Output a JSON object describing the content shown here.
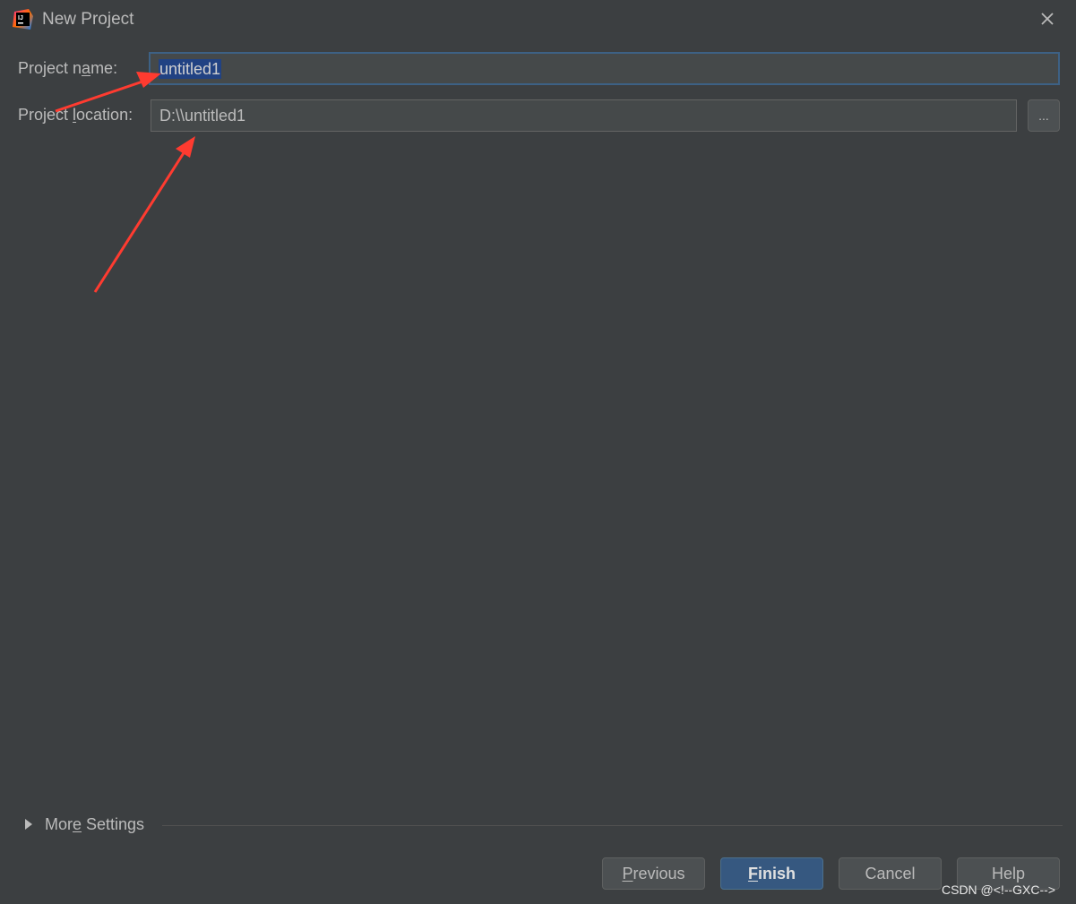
{
  "window": {
    "title": "New Project",
    "app_icon": "intellij-idea-icon",
    "close_icon": "close-icon"
  },
  "form": {
    "project_name": {
      "label_pre": "Project n",
      "label_mnemonic": "a",
      "label_post": "me:",
      "value": "untitled1"
    },
    "project_location": {
      "label_pre": "Project ",
      "label_mnemonic": "l",
      "label_post": "ocation:",
      "value": "D:\\\\untitled1",
      "browse_label": "..."
    }
  },
  "more_settings": {
    "label_pre": "Mor",
    "label_mnemonic": "e",
    "label_post": " Settings",
    "icon": "triangle-right-icon"
  },
  "buttons": {
    "previous_mnemonic": "P",
    "previous_rest": "revious",
    "finish_mnemonic": "F",
    "finish_rest": "inish",
    "cancel": "Cancel",
    "help": "Help"
  },
  "watermark": "CSDN @<!--GXC-->",
  "colors": {
    "background": "#3c3f41",
    "field_bg": "#45494a",
    "focus_border": "#3d6185",
    "selection": "#214283",
    "primary_button": "#365880",
    "annotation_arrow": "#ff3b30"
  }
}
